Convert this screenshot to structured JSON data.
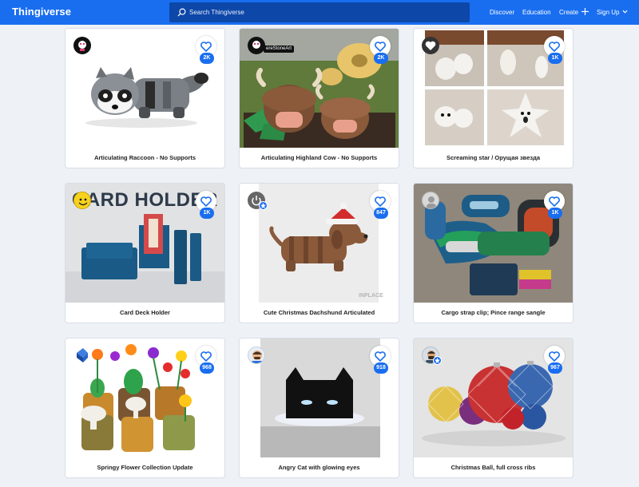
{
  "header": {
    "logo": "Thingiverse",
    "search_placeholder": "Search Thingiverse",
    "nav": {
      "discover": "Discover",
      "education": "Education",
      "create": "Create",
      "signup": "Sign Up"
    }
  },
  "colors": {
    "brand": "#196ef0",
    "search_bg": "#0d47a8",
    "badge": "#196ef0"
  },
  "cards": [
    {
      "title": "Articulating Raccoon - No Supports",
      "likes": "2K"
    },
    {
      "title": "Articulating Highland Cow - No Supports",
      "likes": "2K",
      "avatar_tag": "ereStoneArt"
    },
    {
      "title": "Screaming star / Орущая звезда",
      "likes": "1K"
    },
    {
      "title": "Card Deck Holder",
      "likes": "1K",
      "image_text": "CARD HOLDER"
    },
    {
      "title": "Cute Christmas Dachshund Articulated",
      "likes": "847",
      "watermark": "INPLACE"
    },
    {
      "title": "Cargo strap clip; Pince range sangle",
      "likes": "1K"
    },
    {
      "title": "Springy Flower Collection Update",
      "likes": "968"
    },
    {
      "title": "Angry Cat with glowing eyes",
      "likes": "918"
    },
    {
      "title": "Christmas Ball, full cross ribs",
      "likes": "967"
    }
  ]
}
